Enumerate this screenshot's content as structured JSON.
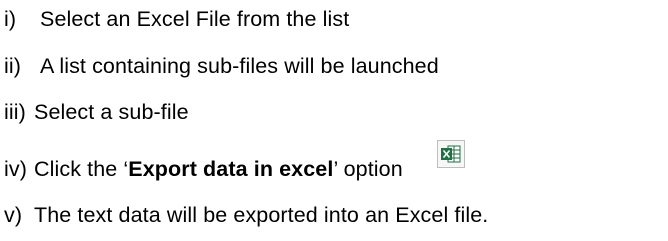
{
  "steps": [
    {
      "num": "i)",
      "text": "Select an Excel File from the list"
    },
    {
      "num": "ii)",
      "text": "A list containing sub-files will be launched"
    },
    {
      "num": "iii)",
      "text": "Select a sub-file"
    },
    {
      "num": "iv)",
      "text_before": "Click the ‘",
      "text_bold": "Export data in excel",
      "text_after": "’ option"
    },
    {
      "num": "v)",
      "text": "The text data will be exported into an Excel file."
    }
  ],
  "icons": {
    "export_excel": "excel-export-icon"
  },
  "colors": {
    "text": "#000000",
    "excel_green": "#1e7145",
    "icon_border": "#bdbdbd"
  }
}
